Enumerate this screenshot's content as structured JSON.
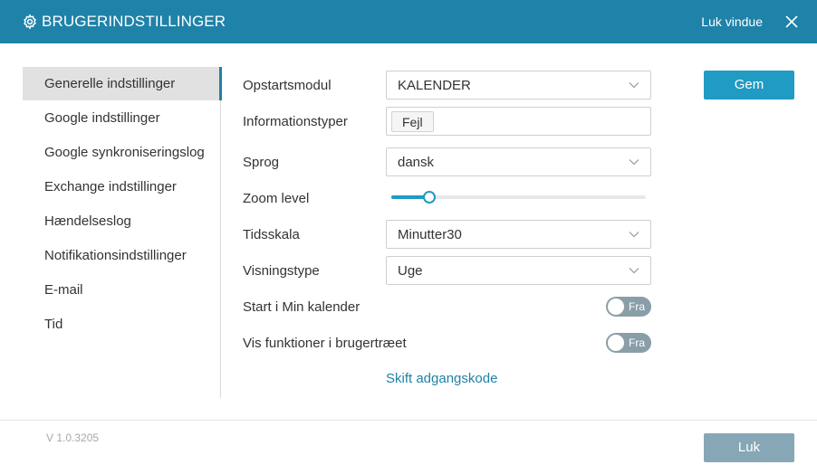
{
  "window": {
    "title": "BRUGERINDSTILLINGER",
    "title_icon": "gear-icon",
    "close_text": "Luk vindue",
    "close_icon": "close-icon",
    "accent_color": "#1f82a8"
  },
  "sidebar": {
    "items": [
      {
        "label": "Generelle indstillinger",
        "active": true
      },
      {
        "label": "Google indstillinger",
        "active": false
      },
      {
        "label": "Google synkroniseringslog",
        "active": false
      },
      {
        "label": "Exchange indstillinger",
        "active": false
      },
      {
        "label": "Hændelseslog",
        "active": false
      },
      {
        "label": "Notifikationsindstillinger",
        "active": false
      },
      {
        "label": "E-mail",
        "active": false
      },
      {
        "label": "Tid",
        "active": false
      }
    ]
  },
  "form": {
    "startup_module": {
      "label": "Opstartsmodul",
      "value": "KALENDER"
    },
    "info_types": {
      "label": "Informationstyper",
      "tags": [
        "Fejl"
      ]
    },
    "language": {
      "label": "Sprog",
      "value": "dansk"
    },
    "zoom": {
      "label": "Zoom level",
      "value_fraction": 0.15
    },
    "timescale": {
      "label": "Tidsskala",
      "value": "Minutter30"
    },
    "view_type": {
      "label": "Visningstype",
      "value": "Uge"
    },
    "start_in_my_calendar": {
      "label": "Start i Min kalender",
      "state": "Fra"
    },
    "show_functions": {
      "label": "Vis funktioner i brugertræet",
      "state": "Fra"
    },
    "change_password_link": "Skift adgangskode"
  },
  "buttons": {
    "save": "Gem",
    "close": "Luk"
  },
  "footer": {
    "version": "V 1.0.3205"
  }
}
